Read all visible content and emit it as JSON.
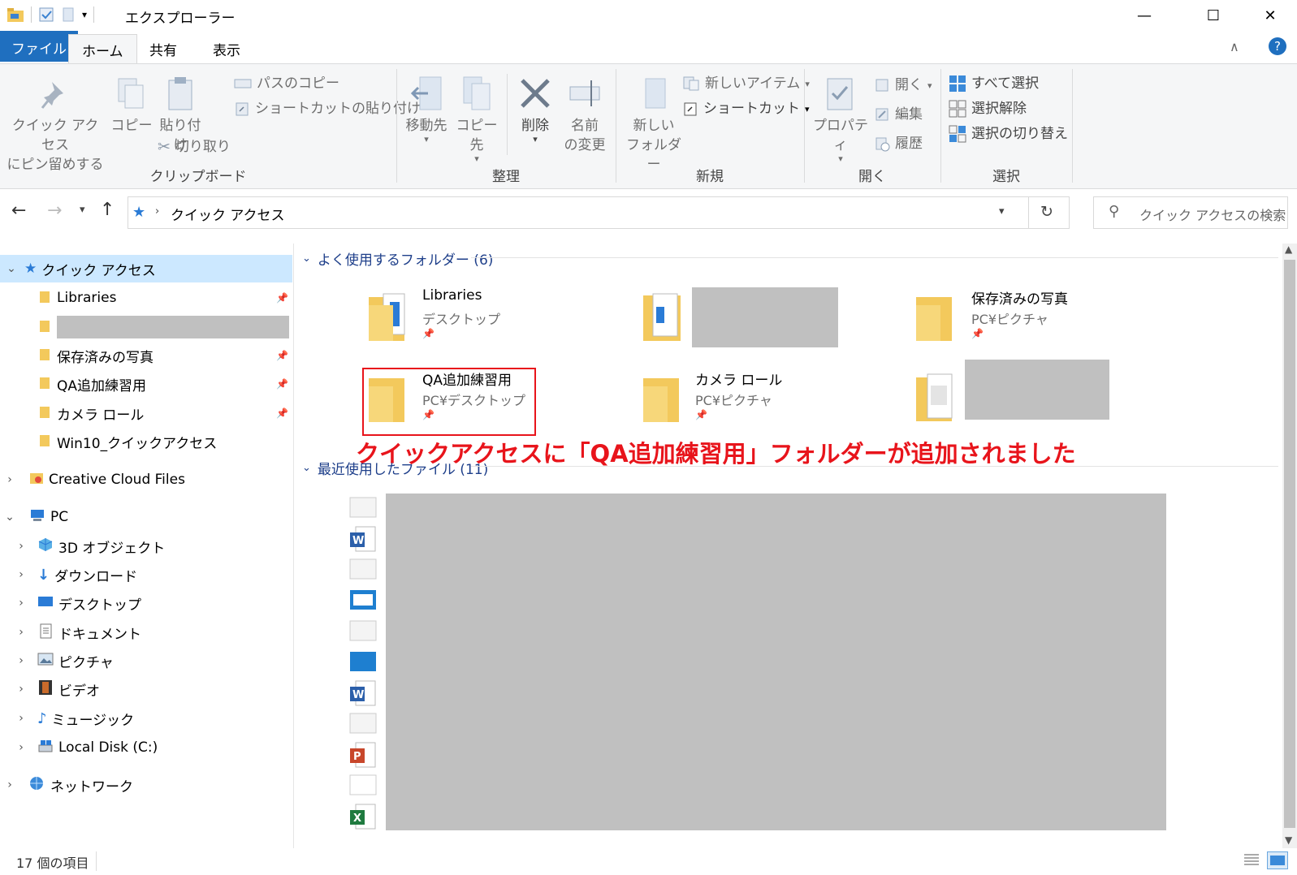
{
  "window": {
    "title": "エクスプローラー",
    "controls": {
      "minimize": "—",
      "maximize": "☐",
      "close": "✕"
    }
  },
  "tabs": {
    "file": "ファイル",
    "home": "ホーム",
    "share": "共有",
    "view": "表示"
  },
  "ribbon": {
    "clipboard": {
      "title": "クリップボード",
      "pin_line1": "クイック アクセス",
      "pin_line2": "にピン留めする",
      "copy": "コピー",
      "paste": "貼り付け",
      "copy_path": "パスのコピー",
      "paste_shortcut": "ショートカットの貼り付け",
      "cut": "切り取り"
    },
    "organize": {
      "title": "整理",
      "move_to": "移動先",
      "copy_to": "コピー先",
      "delete": "削除",
      "rename_line1": "名前",
      "rename_line2": "の変更"
    },
    "new": {
      "title": "新規",
      "new_folder_line1": "新しい",
      "new_folder_line2": "フォルダー",
      "new_item": "新しいアイテム",
      "shortcut": "ショートカット"
    },
    "open": {
      "title": "開く",
      "properties": "プロパティ",
      "open": "開く",
      "edit": "編集",
      "history": "履歴"
    },
    "select": {
      "title": "選択",
      "select_all": "すべて選択",
      "select_none": "選択解除",
      "invert": "選択の切り替え"
    }
  },
  "address": {
    "path": "クイック アクセス",
    "search_placeholder": "クイック アクセスの検索"
  },
  "nav": {
    "quick_access": "クイック アクセス",
    "pinned": [
      "Libraries",
      "",
      "保存済みの写真",
      "QA追加練習用",
      "カメラ ロール",
      "Win10_クイックアクセス"
    ],
    "creative_cloud": "Creative Cloud Files",
    "pc": "PC",
    "pc_items": [
      "3D オブジェクト",
      "ダウンロード",
      "デスクトップ",
      "ドキュメント",
      "ピクチャ",
      "ビデオ",
      "ミュージック",
      "Local Disk (C:)"
    ],
    "network": "ネットワーク"
  },
  "content": {
    "frequent_header": "よく使用するフォルダー (6)",
    "recent_header": "最近使用したファイル (11)",
    "folders": [
      {
        "name": "Libraries",
        "path": "デスクトップ"
      },
      {
        "name": "",
        "path": ""
      },
      {
        "name": "保存済みの写真",
        "path": "PC¥ピクチャ"
      },
      {
        "name": "QA追加練習用",
        "path": "PC¥デスクトップ"
      },
      {
        "name": "カメラ ロール",
        "path": "PC¥ピクチャ"
      },
      {
        "name": "",
        "path": ""
      }
    ],
    "annotation": "クイックアクセスに「QA追加練習用」フォルダーが追加されました"
  },
  "status": {
    "item_count": "17 個の項目"
  },
  "colors": {
    "accent": "#1f6fbf",
    "folder": "#f3c95c",
    "annotation": "#e8141b",
    "selection": "#cce8ff"
  }
}
